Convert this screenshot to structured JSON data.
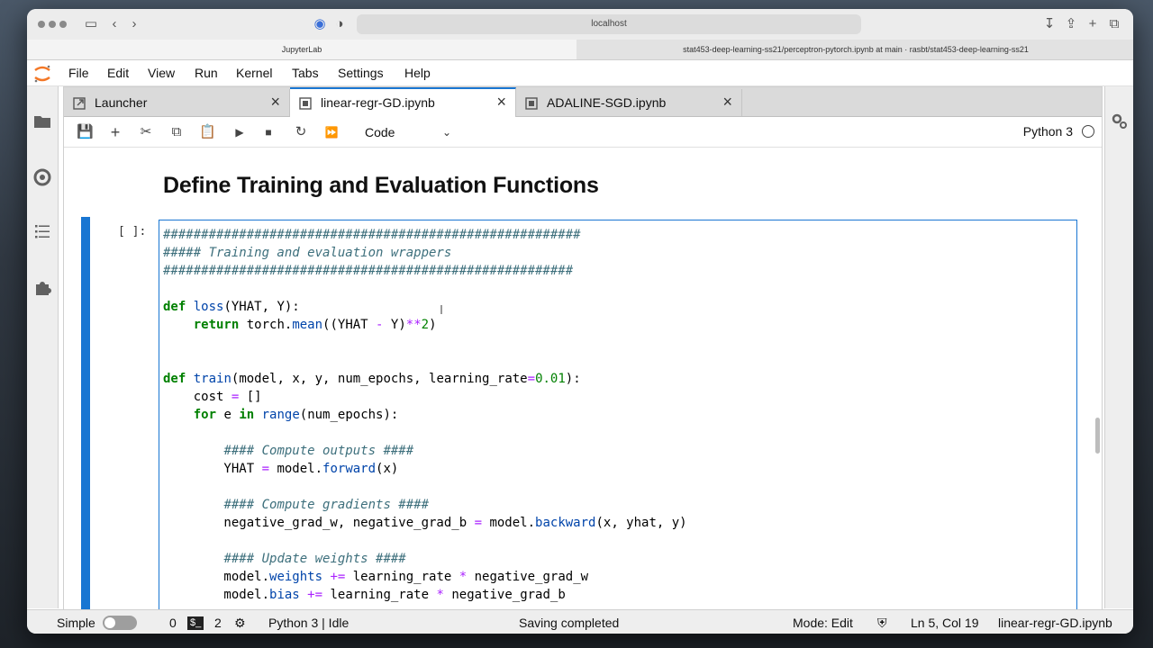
{
  "browser": {
    "url": "localhost",
    "tabs": [
      {
        "label": "JupyterLab",
        "active": true
      },
      {
        "label": "stat453-deep-learning-ss21/perceptron-pytorch.ipynb at main · rasbt/stat453-deep-learning-ss21",
        "active": false
      }
    ]
  },
  "menu": [
    "File",
    "Edit",
    "View",
    "Run",
    "Kernel",
    "Tabs",
    "Settings",
    "Help"
  ],
  "doc_tabs": [
    {
      "label": "Launcher",
      "icon": "launcher-icon",
      "active": false
    },
    {
      "label": "linear-regr-GD.ipynb",
      "icon": "notebook-icon",
      "active": true
    },
    {
      "label": "ADALINE-SGD.ipynb",
      "icon": "notebook-icon",
      "active": false
    }
  ],
  "toolbar": {
    "cell_type": "Code",
    "kernel": "Python 3"
  },
  "notebook": {
    "heading": "Define Training and Evaluation Functions",
    "prompt": "[ ]:",
    "accent_color": "#1976d2"
  },
  "code_lines": [
    [
      [
        "c",
        "#######################################################"
      ]
    ],
    [
      [
        "c",
        "##### Training and evaluation wrappers"
      ]
    ],
    [
      [
        "c",
        "######################################################"
      ]
    ],
    [],
    [
      [
        "k",
        "def"
      ],
      [
        "t",
        " "
      ],
      [
        "f",
        "loss"
      ],
      [
        "t",
        "(YHAT, Y):"
      ]
    ],
    [
      [
        "t",
        "    "
      ],
      [
        "k",
        "return"
      ],
      [
        "t",
        " torch."
      ],
      [
        "f",
        "mean"
      ],
      [
        "t",
        "((YHAT "
      ],
      [
        "o",
        "-"
      ],
      [
        "t",
        " Y)"
      ],
      [
        "o",
        "**"
      ],
      [
        "n",
        "2"
      ],
      [
        "t",
        ")"
      ]
    ],
    [],
    [],
    [
      [
        "k",
        "def"
      ],
      [
        "t",
        " "
      ],
      [
        "f",
        "train"
      ],
      [
        "t",
        "(model, x, y, num_epochs, learning_rate"
      ],
      [
        "o",
        "="
      ],
      [
        "n",
        "0.01"
      ],
      [
        "t",
        "):"
      ]
    ],
    [
      [
        "t",
        "    cost "
      ],
      [
        "o",
        "="
      ],
      [
        "t",
        " []"
      ]
    ],
    [
      [
        "t",
        "    "
      ],
      [
        "k",
        "for"
      ],
      [
        "t",
        " e "
      ],
      [
        "k",
        "in"
      ],
      [
        "t",
        " "
      ],
      [
        "f",
        "range"
      ],
      [
        "t",
        "(num_epochs):"
      ]
    ],
    [],
    [
      [
        "t",
        "        "
      ],
      [
        "c",
        "#### Compute outputs ####"
      ]
    ],
    [
      [
        "t",
        "        YHAT "
      ],
      [
        "o",
        "="
      ],
      [
        "t",
        " model."
      ],
      [
        "f",
        "forward"
      ],
      [
        "t",
        "(x)"
      ]
    ],
    [],
    [
      [
        "t",
        "        "
      ],
      [
        "c",
        "#### Compute gradients ####"
      ]
    ],
    [
      [
        "t",
        "        negative_grad_w, negative_grad_b "
      ],
      [
        "o",
        "="
      ],
      [
        "t",
        " model."
      ],
      [
        "f",
        "backward"
      ],
      [
        "t",
        "(x, yhat, y)"
      ]
    ],
    [],
    [
      [
        "t",
        "        "
      ],
      [
        "c",
        "#### Update weights ####"
      ]
    ],
    [
      [
        "t",
        "        model."
      ],
      [
        "f",
        "weights"
      ],
      [
        "t",
        " "
      ],
      [
        "o",
        "+="
      ],
      [
        "t",
        " learning_rate "
      ],
      [
        "o",
        "*"
      ],
      [
        "t",
        " negative_grad_w"
      ]
    ],
    [
      [
        "t",
        "        model."
      ],
      [
        "f",
        "bias"
      ],
      [
        "t",
        " "
      ],
      [
        "o",
        "+="
      ],
      [
        "t",
        " learning_rate "
      ],
      [
        "o",
        "*"
      ],
      [
        "t",
        " negative_grad_b"
      ]
    ]
  ],
  "status": {
    "mode_label": "Simple",
    "terminals": "0",
    "kernels": "2",
    "kernel_status": "Python 3 | Idle",
    "message": "Saving completed",
    "edit_mode": "Mode: Edit",
    "cursor": "Ln 5, Col 19",
    "filename": "linear-regr-GD.ipynb"
  }
}
